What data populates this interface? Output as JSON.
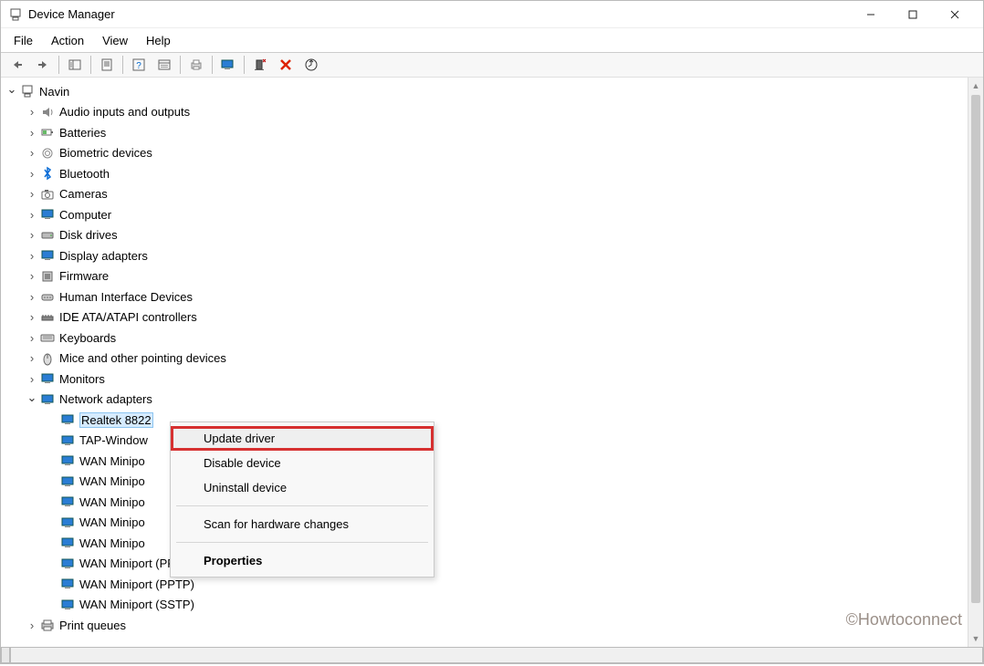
{
  "window": {
    "title": "Device Manager"
  },
  "menu": {
    "file": "File",
    "action": "Action",
    "view": "View",
    "help": "Help"
  },
  "toolbar": {
    "back": "back-icon",
    "forward": "forward-icon",
    "show_hide": "show-hide-icon",
    "properties": "properties-icon",
    "help": "help-icon",
    "list": "list-icon",
    "print": "print-icon",
    "monitor": "monitor-icon",
    "pc": "pc-icon",
    "delete": "delete-icon",
    "scan": "scan-icon"
  },
  "tree": {
    "root": "Navin",
    "categories": [
      {
        "label": "Audio inputs and outputs",
        "icon": "audio"
      },
      {
        "label": "Batteries",
        "icon": "battery"
      },
      {
        "label": "Biometric devices",
        "icon": "biometric"
      },
      {
        "label": "Bluetooth",
        "icon": "bluetooth"
      },
      {
        "label": "Cameras",
        "icon": "camera"
      },
      {
        "label": "Computer",
        "icon": "computer"
      },
      {
        "label": "Disk drives",
        "icon": "disk"
      },
      {
        "label": "Display adapters",
        "icon": "display"
      },
      {
        "label": "Firmware",
        "icon": "firmware"
      },
      {
        "label": "Human Interface Devices",
        "icon": "hid"
      },
      {
        "label": "IDE ATA/ATAPI controllers",
        "icon": "ide"
      },
      {
        "label": "Keyboards",
        "icon": "keyboard"
      },
      {
        "label": "Mice and other pointing devices",
        "icon": "mouse"
      },
      {
        "label": "Monitors",
        "icon": "monitor"
      }
    ],
    "network": {
      "label": "Network adapters",
      "children": [
        "Realtek 8822",
        "TAP-Window",
        "WAN Minipo",
        "WAN Minipo",
        "WAN Minipo",
        "WAN Minipo",
        "WAN Minipo",
        "WAN Miniport (PPPOE)",
        "WAN Miniport (PPTP)",
        "WAN Miniport (SSTP)"
      ]
    },
    "after": [
      {
        "label": "Print queues",
        "icon": "printer"
      }
    ]
  },
  "ctx": {
    "update": "Update driver",
    "disable": "Disable device",
    "uninstall": "Uninstall device",
    "scan": "Scan for hardware changes",
    "properties": "Properties"
  },
  "watermark": "©Howtoconnect"
}
